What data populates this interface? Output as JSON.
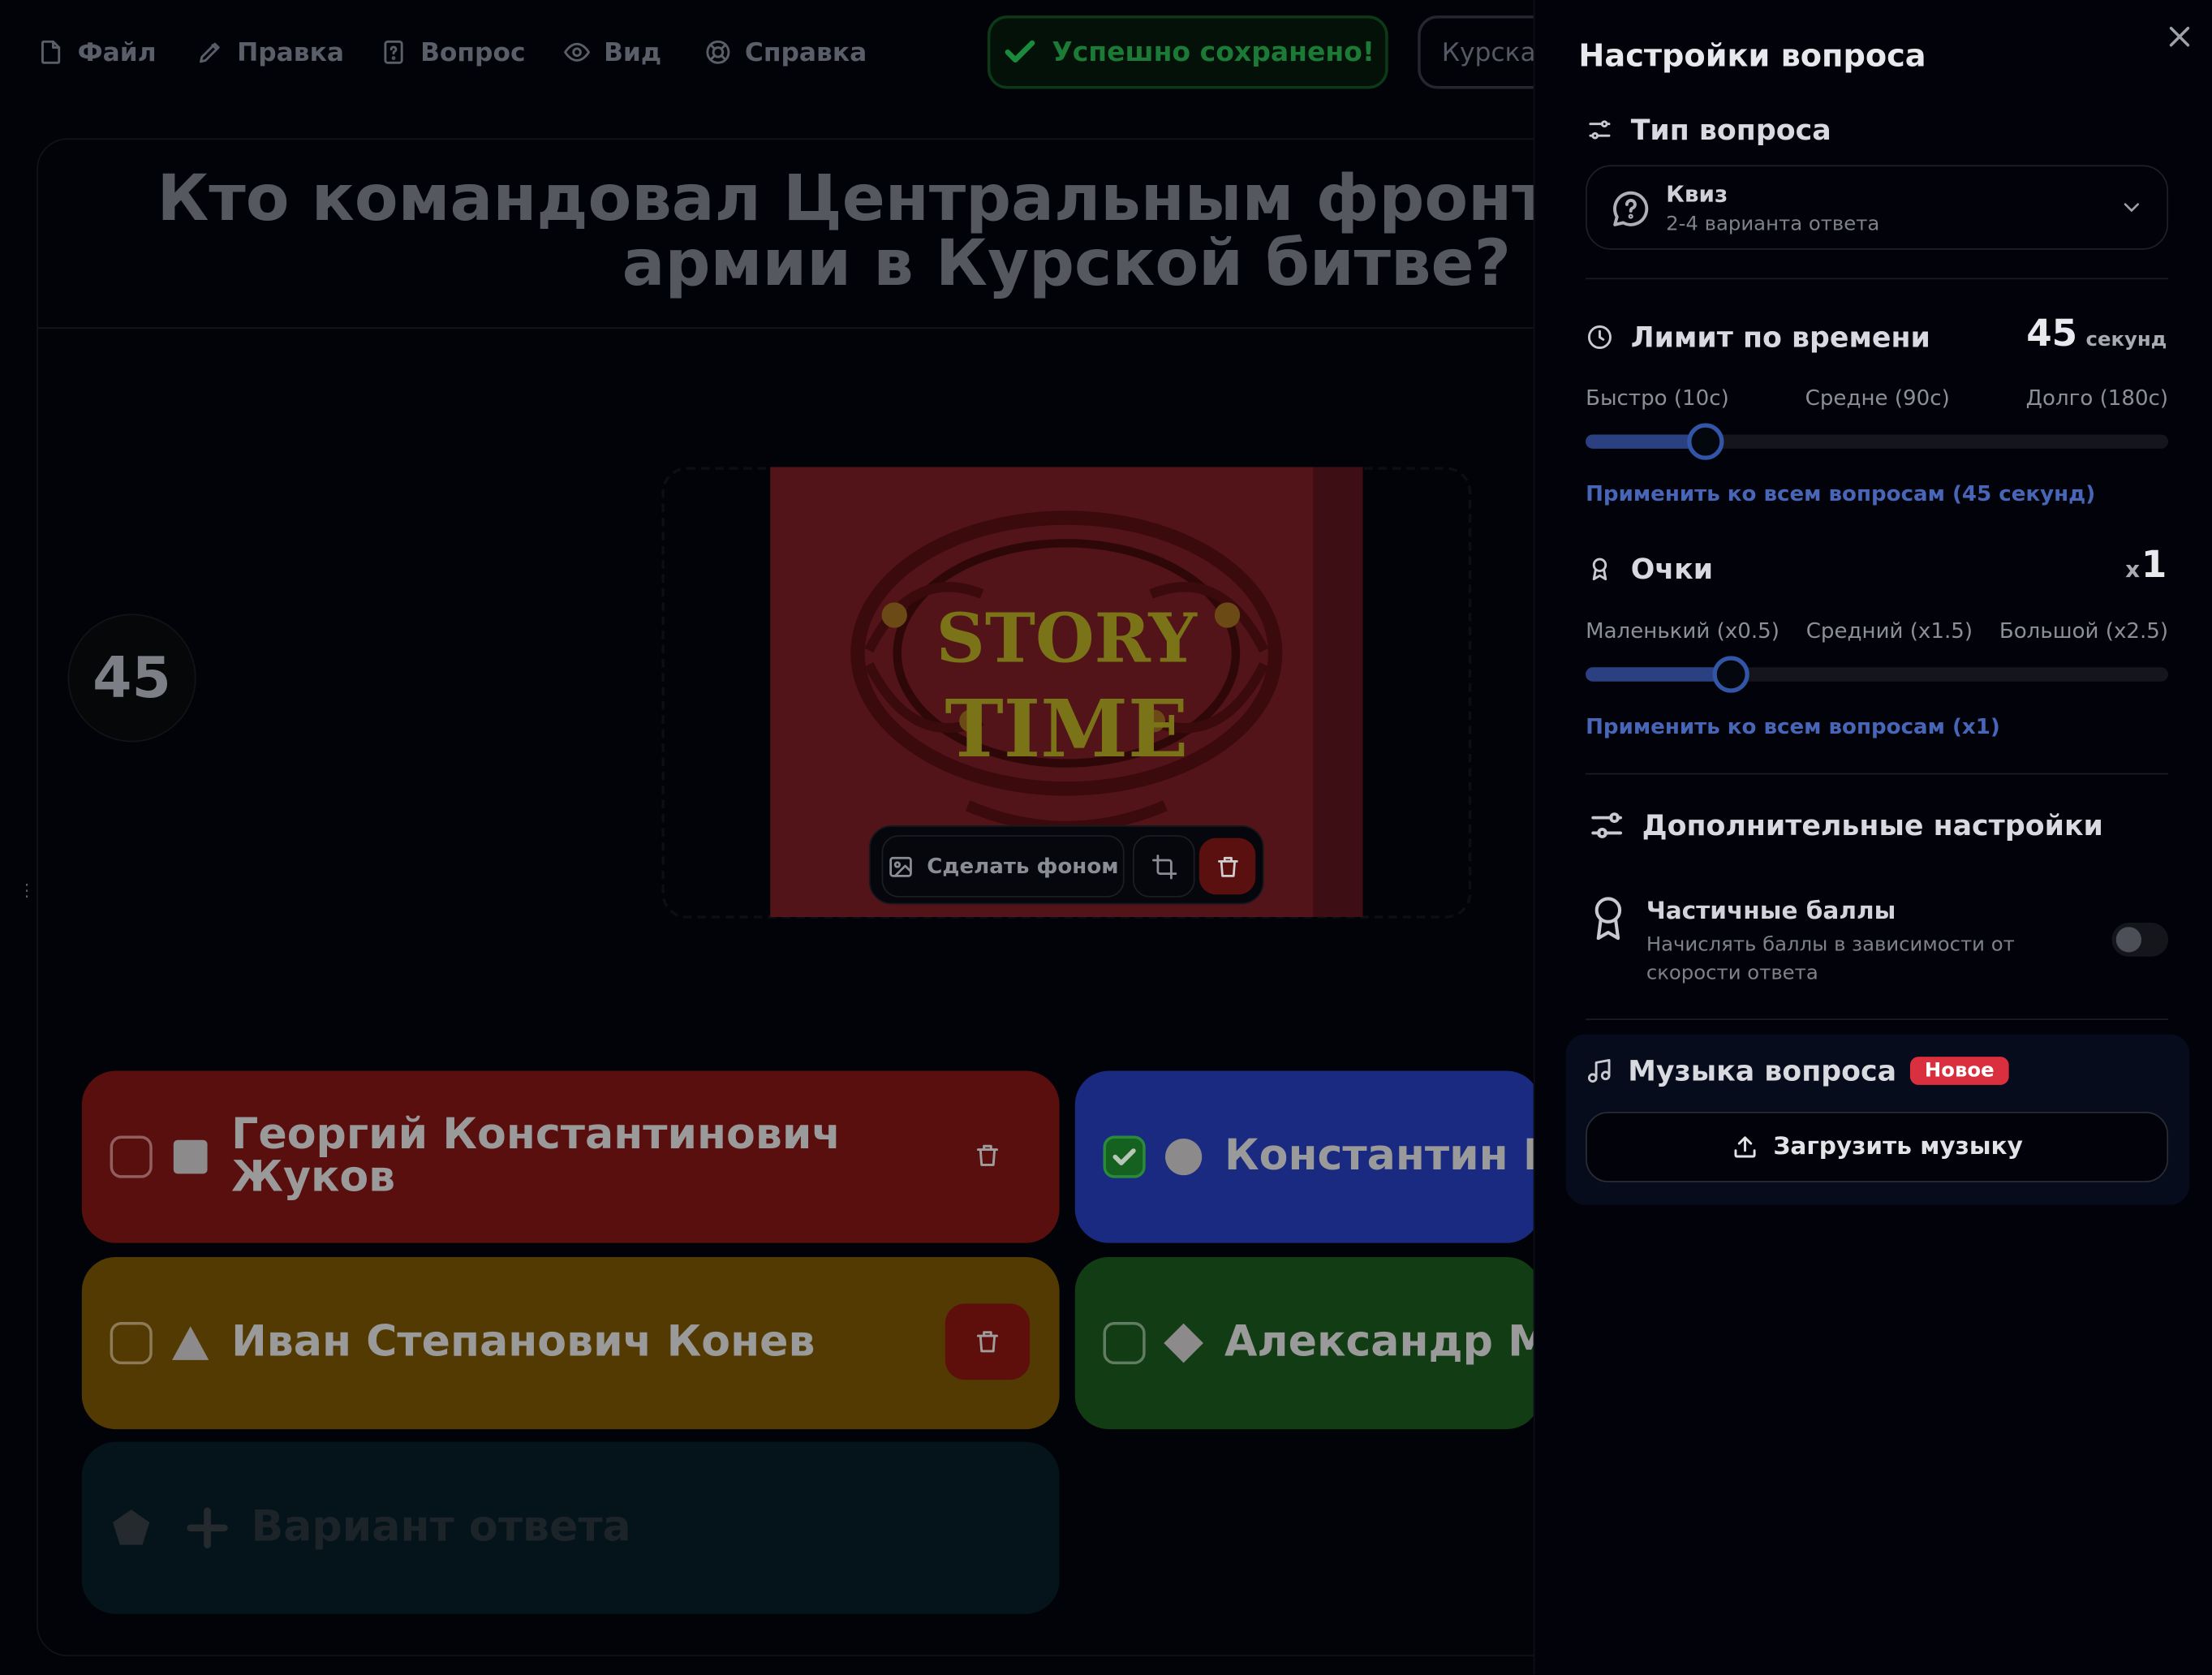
{
  "menu": {
    "file": "Файл",
    "edit": "Правка",
    "question": "Вопрос",
    "view": "Вид",
    "help": "Справка"
  },
  "status": {
    "saved": "Успешно сохранено!"
  },
  "quiz_name": "Курская",
  "question": {
    "title": "Кто командовал Центральным фронтом Красной армии в Курской битве?",
    "timer": "45",
    "media_caption": "STORY TIME"
  },
  "media_tools": {
    "set_background": "Сделать фоном"
  },
  "answers": [
    {
      "text": "Георгий Константинович Жуков",
      "color": "#5a0f0f",
      "shape": "square",
      "correct": false
    },
    {
      "text": "Константин Константинович Рокоссовский",
      "color": "#1a2a80",
      "shape": "circle",
      "correct": true
    },
    {
      "text": "Иван Степанович Конев",
      "color": "#533a02",
      "shape": "triangle",
      "correct": false
    },
    {
      "text": "Александр Михайлович Василевский",
      "color": "#123c13",
      "shape": "diamond",
      "correct": false
    }
  ],
  "add_answer": {
    "placeholder": "Вариант ответа"
  },
  "panel": {
    "title": "Настройки вопроса",
    "type": {
      "label": "Тип вопроса",
      "selected_name": "Квиз",
      "selected_desc": "2-4 варианта ответа"
    },
    "time": {
      "label": "Лимит по времени",
      "value": "45",
      "unit": "секунд",
      "fast": "Быстро (10с)",
      "medium": "Средне (90с)",
      "long": "Долго (180с)",
      "slider_min": 10,
      "slider_max": 180,
      "slider_value": 45,
      "apply_all": "Применить ко всем вопросам (45 секунд)"
    },
    "points": {
      "label": "Очки",
      "prefix": "x",
      "value": "1",
      "small": "Маленький (x0.5)",
      "medium": "Средний (x1.5)",
      "large": "Большой (x2.5)",
      "slider_min": 0.5,
      "slider_max": 2.5,
      "slider_value": 1,
      "apply_all": "Применить ко всем вопросам (x1)"
    },
    "advanced": {
      "label": "Дополнительные настройки",
      "partial_title": "Частичные баллы",
      "partial_desc": "Начислять баллы в зависимости от скорости ответа",
      "partial_enabled": false
    },
    "music": {
      "label": "Музыка вопроса",
      "badge": "Новое",
      "upload": "Загрузить музыку"
    }
  },
  "colors": {
    "accent": "#3355a8",
    "link": "#4866b8",
    "saved": "#1a7a36",
    "badge": "#d92f3f"
  }
}
